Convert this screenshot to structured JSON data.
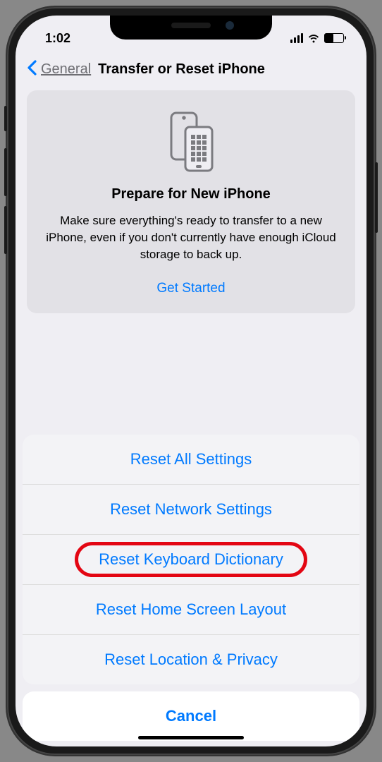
{
  "status": {
    "time": "1:02"
  },
  "nav": {
    "back_label": "General",
    "title": "Transfer or Reset iPhone"
  },
  "prepare_card": {
    "title": "Prepare for New iPhone",
    "description": "Make sure everything's ready to transfer to a new iPhone, even if you don't currently have enough iCloud storage to back up.",
    "cta": "Get Started"
  },
  "sheet": {
    "items": [
      {
        "label": "Reset All Settings"
      },
      {
        "label": "Reset Network Settings"
      },
      {
        "label": "Reset Keyboard Dictionary"
      },
      {
        "label": "Reset Home Screen Layout"
      },
      {
        "label": "Reset Location & Privacy"
      }
    ],
    "cancel": "Cancel"
  }
}
